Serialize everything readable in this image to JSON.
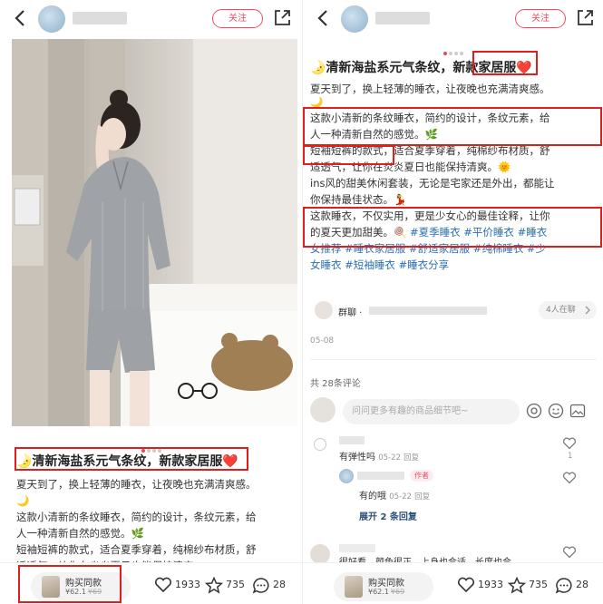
{
  "topbar": {
    "follow_label": "关注"
  },
  "post": {
    "title": "🌛清新海盐系元气条纹，新款家居服❤️",
    "title_right_part1": "🌛清新海盐系元气条纹，新款",
    "title_right_part2": "家居服❤️",
    "p1": "夏天到了，换上轻薄的睡衣，让夜晚也充满清爽感。",
    "moon": "🌙",
    "p2a": "这款小清新的条纹睡衣，简约的设计，条纹元素，给",
    "p2b": "人一种清新自然的感觉。🌿",
    "p3a": "短袖短裤的款式，适合夏季穿着，纯棉纱布材质，舒",
    "p3a_left": "短袖短裤的款式",
    "p3a_right": "，适合夏季穿着，纯棉纱布材质，舒",
    "p3b": "适透气，让你在炎炎夏日也能保持清爽。🌞",
    "p4a": "ins风的甜美休闲套装，无论是宅家还是外出，都能让",
    "p4b": "你保持最佳状态。💃",
    "p5a": "这款睡衣，不仅实用，更是少女心的最佳诠释，让你",
    "p5b_text": "的夏天更加甜美。🍭",
    "tags": [
      "#夏季睡衣",
      "#平价睡衣",
      "#睡衣女推荐",
      "#睡衣家居服",
      "#舒适家居服",
      "#纯棉睡衣",
      "#少女睡衣",
      "#短袖睡衣",
      "#睡衣分享"
    ],
    "tag_line1": [
      "#夏季睡衣",
      "#平价睡衣",
      "#睡衣"
    ],
    "tag_line2": "女推荐 #睡衣家居服 #舒适家居服 #纯棉睡衣 #少",
    "tag_line3": "女睡衣 #短袖睡衣 #睡衣分享",
    "date": "05-08",
    "left_p3b_partial": "适透气，让你在炎炎夏日也能保持清爽。"
  },
  "group": {
    "label": "群聊 ·",
    "members": "4人在聊"
  },
  "comments": {
    "count_label": "共 28条评论",
    "input_placeholder": "问问更多有趣的商品细节吧~",
    "items": [
      {
        "text": "有弹性吗",
        "date": "05-22",
        "reply": "回复",
        "likes": "1"
      },
      {
        "author_badge": "作者",
        "text": "有的哦",
        "date": "05-22",
        "reply": "回复"
      }
    ],
    "expand_label": "展开 2 条回复",
    "partial_text": "很好看，颜色很正，上身也合适，长度也合"
  },
  "bottom": {
    "buy_label": "购买同款",
    "price": "¥62.1",
    "old_price": "¥69",
    "likes": "1933",
    "stars": "735",
    "comments": "28"
  },
  "colors": {
    "accent": "#f04a63",
    "highlight": "#e01e1e",
    "hashtag": "#2a6fb0"
  },
  "icons": [
    "back-icon",
    "share-icon",
    "heart-icon",
    "star-icon",
    "comment-icon",
    "at-icon",
    "emoji-icon",
    "image-icon",
    "chevron-right-icon"
  ]
}
